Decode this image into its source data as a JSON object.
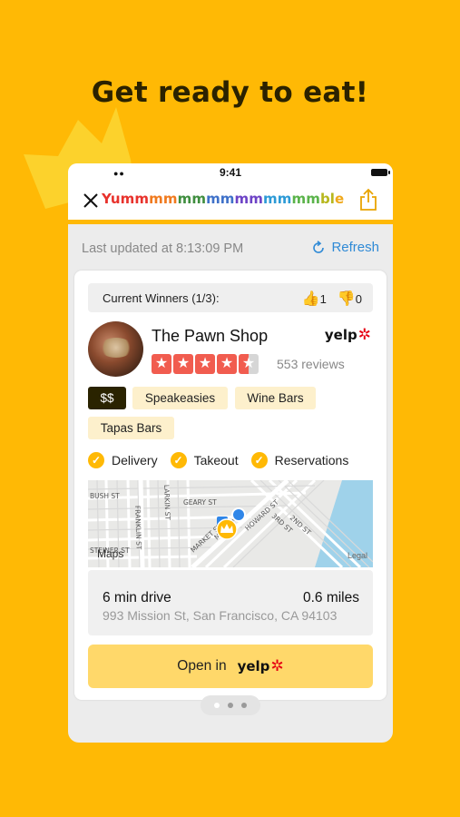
{
  "headline": "Get ready to eat!",
  "status_bar": {
    "time": "9:41"
  },
  "app": {
    "title": "Yummmmmmmmmmmmmmble",
    "title_gradient": [
      "#e8322c",
      "#e8322c",
      "#f07a1e",
      "#3f8e3f",
      "#3f71c9",
      "#6d43c6",
      "#2c9ad6",
      "#5ab34a",
      "#b7b71d",
      "#f0a81a"
    ]
  },
  "updated_text": "Last updated at 8:13:09 PM",
  "refresh_label": "Refresh",
  "winners": {
    "label": "Current Winners (1/3):",
    "up_count": "1",
    "down_count": "0"
  },
  "business": {
    "name": "The Pawn Shop",
    "provider": "yelp",
    "rating": 4.5,
    "reviews": "553 reviews",
    "price": "$$",
    "categories": [
      "Speakeasies",
      "Wine Bars",
      "Tapas Bars"
    ],
    "amenities": [
      "Delivery",
      "Takeout",
      "Reservations"
    ]
  },
  "map": {
    "watermark": "Maps",
    "legal": "Legal",
    "streets": [
      "BUSH ST",
      "GEARY ST",
      "LARKIN ST",
      "FRANKLIN ST",
      "MARKET ST",
      "MISSION ST",
      "HOWARD ST",
      "2ND ST",
      "3RD ST",
      "STEINER ST"
    ]
  },
  "distance": {
    "drive": "6 min drive",
    "miles": "0.6 miles",
    "address": "993 Mission St, San Francisco, CA 94103"
  },
  "open_button": {
    "label": "Open in",
    "provider": "yelp"
  },
  "pager": {
    "count": 3,
    "active": 0
  },
  "colors": {
    "background": "#FFB905",
    "accent_blue": "#2f8ad6",
    "star_red": "#f15c4f",
    "button_yellow": "#FFD86A"
  }
}
